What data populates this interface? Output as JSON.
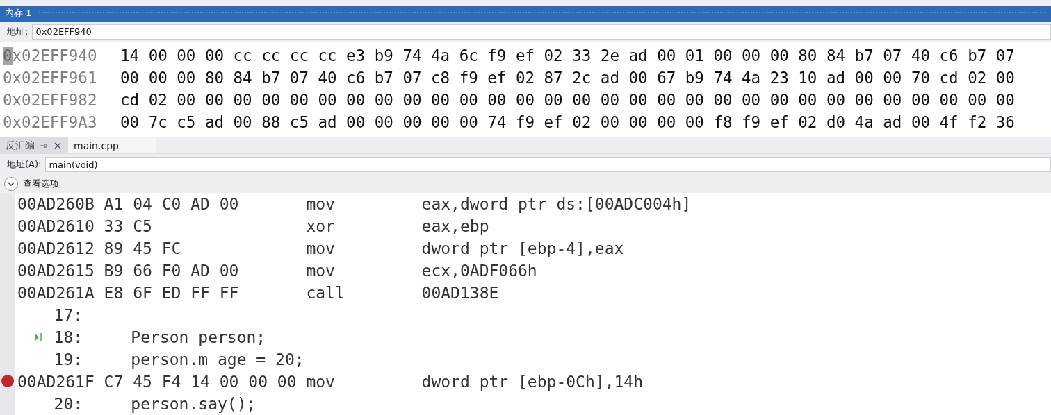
{
  "memory_window": {
    "title": "内存 1",
    "address_label": "地址:",
    "address_value": "0x02EFF940",
    "rows": [
      {
        "address": "0x02EFF940",
        "selected": true,
        "bytes": "14 00 00 00 cc cc cc cc e3 b9 74 4a 6c f9 ef 02 33 2e ad 00 01 00 00 00 80 84 b7 07 40 c6 b7 07"
      },
      {
        "address": "0x02EFF961",
        "selected": false,
        "bytes": "00 00 00 80 84 b7 07 40 c6 b7 07 c8 f9 ef 02 87 2c ad 00 67 b9 74 4a 23 10 ad 00 00 70 cd 02 00"
      },
      {
        "address": "0x02EFF982",
        "selected": false,
        "bytes": "cd 02 00 00 00 00 00 00 00 00 00 00 00 00 00 00 00 00 00 00 00 00 00 00 00 00 00 00 00 00 00 00"
      },
      {
        "address": "0x02EFF9A3",
        "selected": false,
        "bytes": "00 7c c5 ad 00 88 c5 ad 00 00 00 00 00 74 f9 ef 02 00 00 00 00 f8 f9 ef 02 d0 4a ad 00 4f f2 36"
      }
    ]
  },
  "tabs": [
    {
      "label": "反汇编",
      "selected": true
    },
    {
      "label": "main.cpp",
      "selected": false
    }
  ],
  "disassembly": {
    "address_label": "地址(A):",
    "address_value": "main(void)",
    "options_label": "查看选项",
    "lines": [
      {
        "kind": "asm",
        "address": "00AD260B",
        "bytes": "A1 04 C0 AD 00",
        "mnemonic": "mov",
        "operands": "eax,dword ptr ds:[00ADC004h]",
        "breakpoint": false
      },
      {
        "kind": "asm",
        "address": "00AD2610",
        "bytes": "33 C5",
        "mnemonic": "xor",
        "operands": "eax,ebp",
        "breakpoint": false
      },
      {
        "kind": "asm",
        "address": "00AD2612",
        "bytes": "89 45 FC",
        "mnemonic": "mov",
        "operands": "dword ptr [ebp-4],eax",
        "breakpoint": false
      },
      {
        "kind": "asm",
        "address": "00AD2615",
        "bytes": "B9 66 F0 AD 00",
        "mnemonic": "mov",
        "operands": "ecx,0ADF066h",
        "breakpoint": false
      },
      {
        "kind": "asm",
        "address": "00AD261A",
        "bytes": "E8 6F ED FF FF",
        "mnemonic": "call",
        "operands": "00AD138E",
        "breakpoint": false
      },
      {
        "kind": "source",
        "number": "17:",
        "current": false
      },
      {
        "kind": "source",
        "number": "18:",
        "code": "Person person;",
        "current": true
      },
      {
        "kind": "source",
        "number": "19:",
        "code": "person.m_age = 20;",
        "current": false
      },
      {
        "kind": "asm",
        "address": "00AD261F",
        "bytes": "C7 45 F4 14 00 00 00",
        "mnemonic": "mov",
        "operands": "dword ptr [ebp-0Ch],14h",
        "breakpoint": true
      },
      {
        "kind": "source",
        "number": "20:",
        "code": "person.say();",
        "current": false
      }
    ]
  }
}
